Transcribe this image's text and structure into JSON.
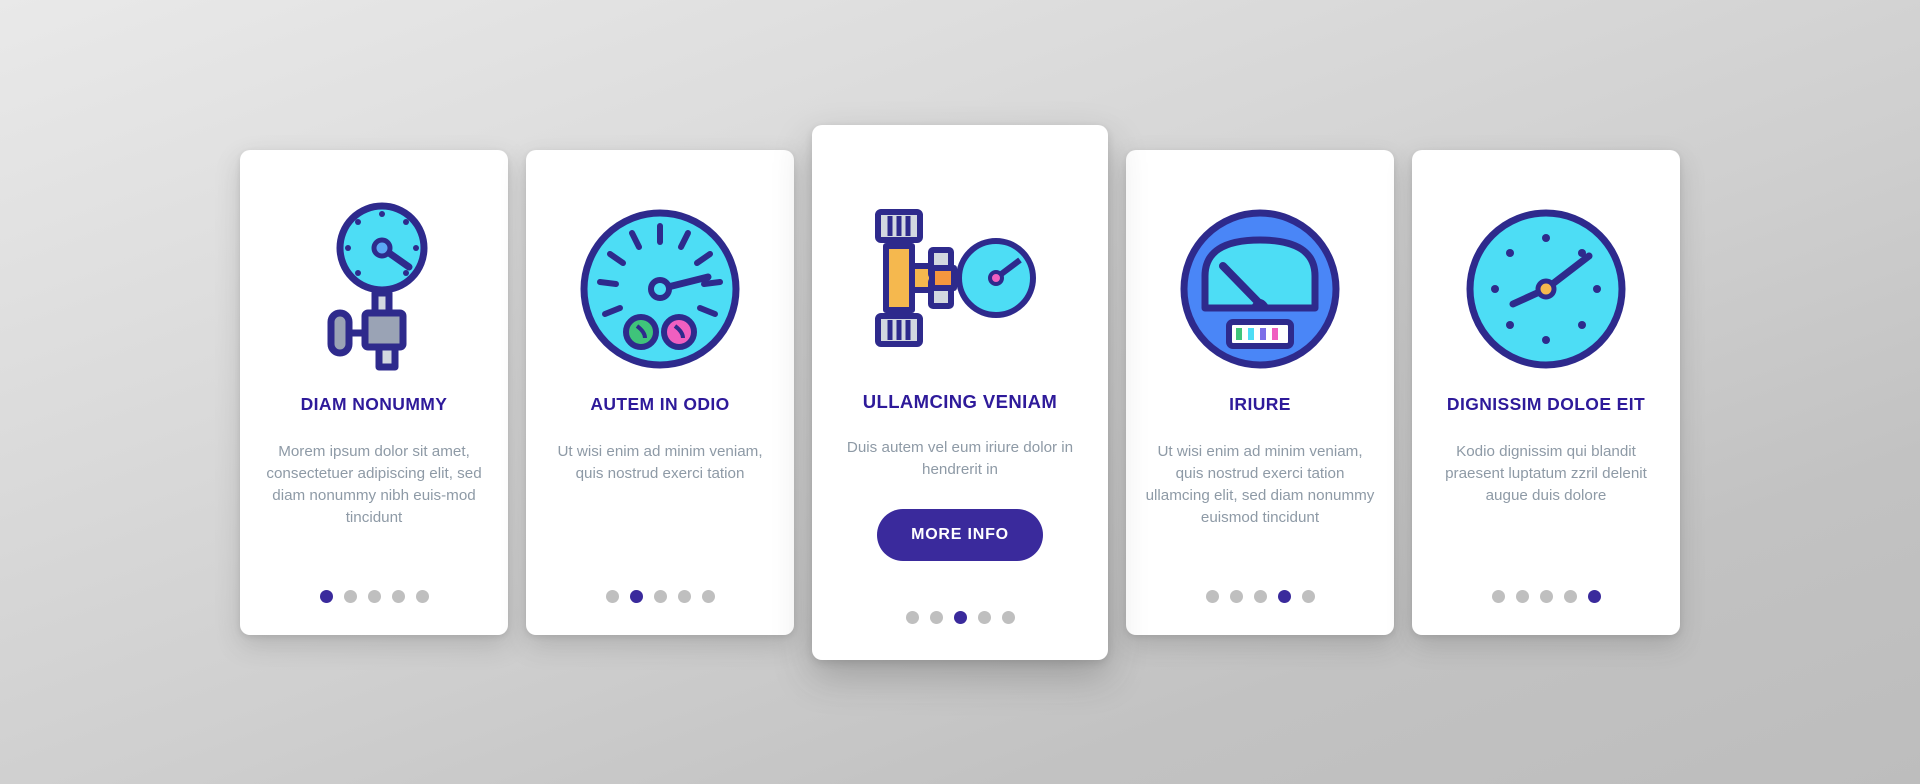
{
  "theme": {
    "title_color": "#2E1A9A",
    "body_color": "#8e9aa6",
    "accent": "#3A2A9C",
    "icon_fill": "#4DDDF5",
    "icon_stroke": "#2E2A8C",
    "dot_inactive": "#bfbfbf",
    "card_bg": "#ffffff",
    "page_bg": "#cfcfcf"
  },
  "cards": [
    {
      "id": "card-diam-nonummy",
      "title": "DIAM NONUMMY",
      "body": "Morem ipsum dolor sit amet, consectetuer adipiscing elit, sed diam nonummy nibh euis-mod tincidunt",
      "icon": "pressure-gauge-valve-icon",
      "featured": false,
      "dots": {
        "count": 5,
        "active_index": 0
      }
    },
    {
      "id": "card-autem-in-odio",
      "title": "AUTEM IN ODIO",
      "body": "Ut wisi enim ad minim veniam, quis nostrud exerci tation",
      "icon": "dial-gauge-icon",
      "featured": false,
      "dots": {
        "count": 5,
        "active_index": 1
      }
    },
    {
      "id": "card-ullamcing-veniam",
      "title": "ULLAMCING VENIAM",
      "body": "Duis autem vel eum iriure dolor in hendrerit in",
      "icon": "pipe-manometer-icon",
      "featured": true,
      "button_label": "MORE INFO",
      "dots": {
        "count": 5,
        "active_index": 2
      }
    },
    {
      "id": "card-iriure",
      "title": "IRIURE",
      "body": "Ut wisi enim ad minim veniam, quis nostrud exerci tation ullamcing elit, sed diam nonummy euismod tincidunt",
      "icon": "speedometer-icon",
      "featured": false,
      "dots": {
        "count": 5,
        "active_index": 3
      }
    },
    {
      "id": "card-dignissim-doloe-eit",
      "title": "DIGNISSIM DOLOE EIT",
      "body": "Kodio dignissim qui blandit praesent luptatum zzril delenit augue duis dolore",
      "icon": "round-gauge-icon",
      "featured": false,
      "dots": {
        "count": 5,
        "active_index": 4
      }
    }
  ]
}
